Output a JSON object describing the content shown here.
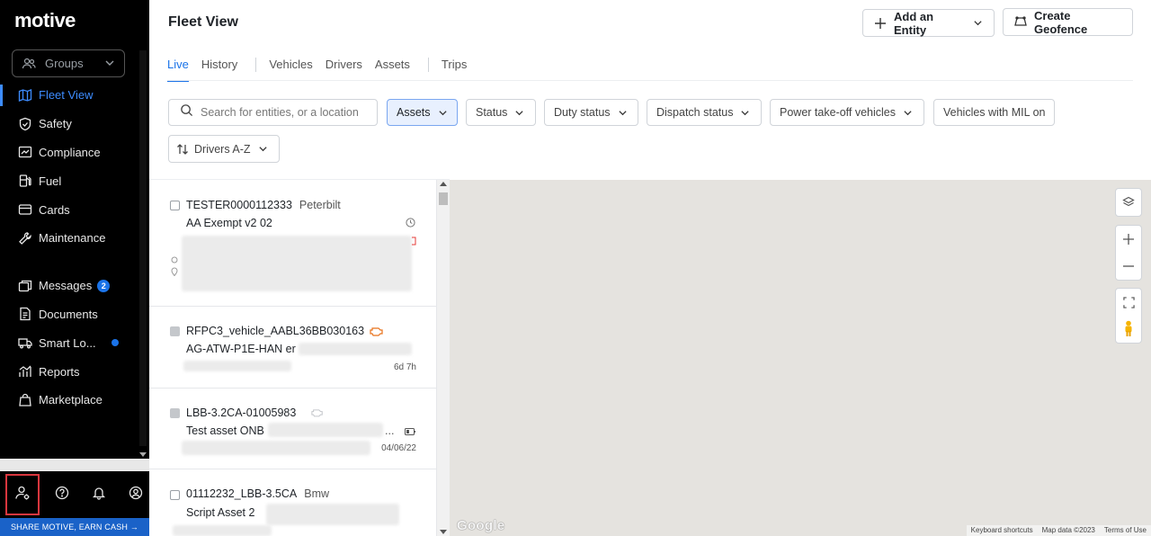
{
  "sidebar": {
    "logo": "motive",
    "groups_label": "Groups",
    "items": [
      {
        "label": "Fleet View",
        "icon": "map-icon",
        "active": true
      },
      {
        "label": "Safety",
        "icon": "shield-icon"
      },
      {
        "label": "Compliance",
        "icon": "chart-card-icon"
      },
      {
        "label": "Fuel",
        "icon": "fuel-icon"
      },
      {
        "label": "Cards",
        "icon": "card-icon"
      },
      {
        "label": "Maintenance",
        "icon": "wrench-icon"
      }
    ],
    "items2": [
      {
        "label": "Messages",
        "icon": "message-icon",
        "badge": "2"
      },
      {
        "label": "Documents",
        "icon": "document-icon"
      },
      {
        "label": "Smart Lo...",
        "icon": "truck-icon",
        "dot": true
      },
      {
        "label": "Reports",
        "icon": "reports-icon"
      },
      {
        "label": "Marketplace",
        "icon": "marketplace-icon"
      }
    ],
    "share_label": "SHARE MOTIVE, EARN CASH →"
  },
  "header": {
    "title": "Fleet View",
    "add_entity_label": "Add an Entity",
    "create_geofence_label": "Create Geofence"
  },
  "tabs": [
    "Live",
    "History",
    "Vehicles",
    "Drivers",
    "Assets",
    "Trips"
  ],
  "filters": {
    "search_placeholder": "Search for entities, or a location",
    "items": [
      "Assets",
      "Status",
      "Duty status",
      "Dispatch status",
      "Power take-off vehicles",
      "Vehicles with MIL on"
    ],
    "sort_label": "Drivers A-Z"
  },
  "entities": [
    {
      "name": "TESTER0000112333",
      "make": "Peterbilt",
      "subtitle": "AA Exempt v2 02",
      "meta": ""
    },
    {
      "name": "RFPC3_vehicle_AABL36BB030163",
      "make": "",
      "subtitle": "AG-ATW-P1E-HAN er",
      "meta": "6d 7h"
    },
    {
      "name": "LBB-3.2CA-01005983",
      "make": "",
      "subtitle": "Test asset ONB",
      "meta": "04/06/22",
      "ellipsis": "..."
    },
    {
      "name": "01112232_LBB-3.5CA",
      "make": "Bmw",
      "subtitle": "Script Asset 2",
      "meta": ""
    }
  ],
  "map": {
    "logo": "Google",
    "attribution": [
      "Keyboard shortcuts",
      "Map data ©2023",
      "Terms of Use"
    ]
  },
  "colors": {
    "accent": "#1a73e8",
    "sidebar_bg": "#000000",
    "map_bg": "#e5e3df",
    "highlight": "#d9363e"
  }
}
